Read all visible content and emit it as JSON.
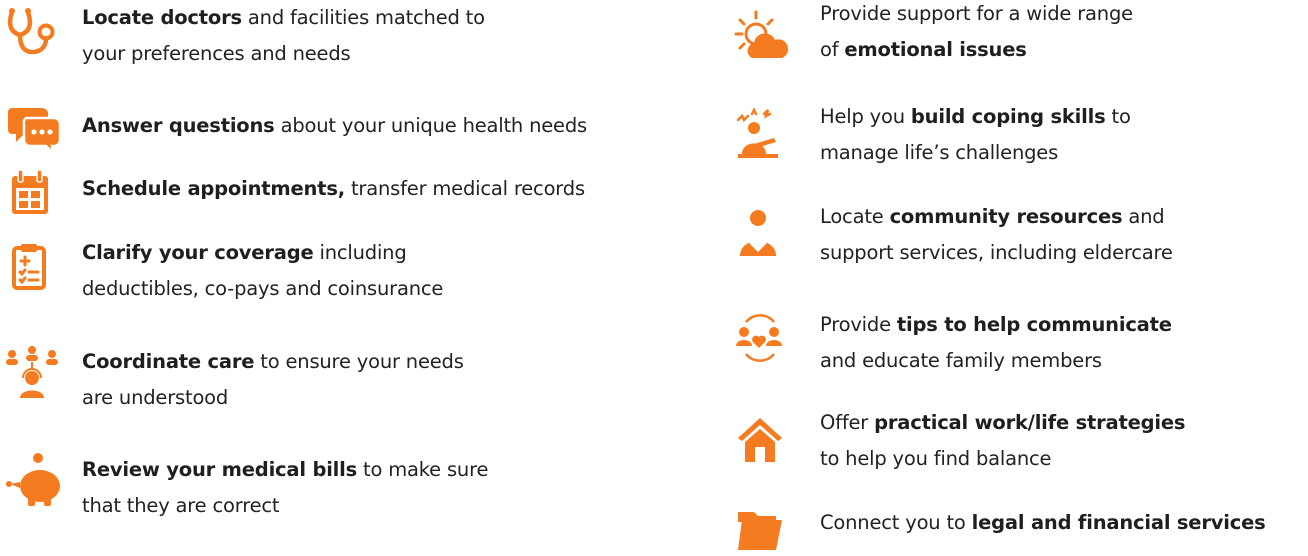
{
  "accent_color": "#f47b20",
  "left_column": [
    {
      "icon": "stethoscope-icon",
      "lines": [
        [
          {
            "b": "Locate doctors"
          },
          {
            "t": " and facilities matched to"
          }
        ],
        [
          {
            "t": "your preferences and needs"
          }
        ]
      ]
    },
    {
      "icon": "chat-bubbles-icon",
      "lines": [
        [
          {
            "b": "Answer questions"
          },
          {
            "t": " about your unique health needs"
          }
        ]
      ]
    },
    {
      "icon": "calendar-icon",
      "lines": [
        [
          {
            "b": "Schedule appointments,"
          },
          {
            "t": " transfer medical records"
          }
        ]
      ]
    },
    {
      "icon": "clipboard-icon",
      "lines": [
        [
          {
            "b": "Clarify your coverage"
          },
          {
            "t": " including"
          }
        ],
        [
          {
            "t": "deductibles, co-pays and coinsurance"
          }
        ]
      ]
    },
    {
      "icon": "care-team-icon",
      "lines": [
        [
          {
            "b": "Coordinate care"
          },
          {
            "t": " to ensure your needs"
          }
        ],
        [
          {
            "t": "are understood"
          }
        ]
      ]
    },
    {
      "icon": "piggy-bank-icon",
      "lines": [
        [
          {
            "b": "Review your medical bills"
          },
          {
            "t": " to make sure"
          }
        ],
        [
          {
            "t": "that they are correct"
          }
        ]
      ]
    }
  ],
  "right_column": [
    {
      "icon": "sun-cloud-icon",
      "lines": [
        [
          {
            "t": "Provide support for a wide range"
          }
        ],
        [
          {
            "t": "of "
          },
          {
            "b": "emotional issues"
          }
        ]
      ]
    },
    {
      "icon": "stressed-person-icon",
      "lines": [
        [
          {
            "t": "Help you "
          },
          {
            "b": "build coping skills"
          },
          {
            "t": " to"
          }
        ],
        [
          {
            "t": "manage life’s challenges"
          }
        ]
      ]
    },
    {
      "icon": "person-heart-icon",
      "lines": [
        [
          {
            "t": "Locate "
          },
          {
            "b": "community resources"
          },
          {
            "t": " and"
          }
        ],
        [
          {
            "t": "support services, including eldercare"
          }
        ]
      ]
    },
    {
      "icon": "family-heart-icon",
      "lines": [
        [
          {
            "t": "Provide "
          },
          {
            "b": "tips to help communicate"
          }
        ],
        [
          {
            "t": "and educate family members"
          }
        ]
      ]
    },
    {
      "icon": "house-icon",
      "lines": [
        [
          {
            "t": "Offer "
          },
          {
            "b": "practical work/life strategies"
          }
        ],
        [
          {
            "t": "to help you find balance"
          }
        ]
      ]
    },
    {
      "icon": "folder-icon",
      "lines": [
        [
          {
            "t": "Connect you to "
          },
          {
            "b": "legal and financial services"
          }
        ]
      ]
    }
  ]
}
